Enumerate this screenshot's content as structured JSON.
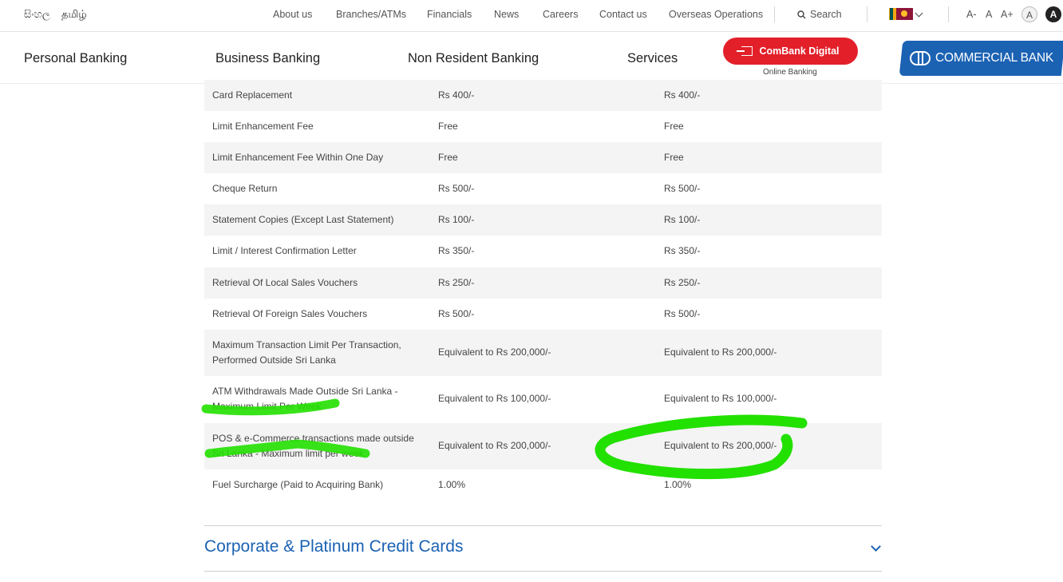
{
  "languages": {
    "sinhala": "සිංහල",
    "tamil": "தமிழ்"
  },
  "top_links": [
    "About us",
    "Branches/ATMs",
    "Financials",
    "News",
    "Careers",
    "Contact us",
    "Overseas Operations"
  ],
  "search": {
    "label": "Search",
    "icon": "search-icon"
  },
  "font_size_controls": [
    "A-",
    "A",
    "A+"
  ],
  "contrast_controls": {
    "light": "A",
    "dark": "A"
  },
  "main_nav": [
    "Personal Banking",
    "Business Banking",
    "Non Resident Banking",
    "Services"
  ],
  "combank_digital": {
    "label": "ComBank Digital",
    "sub": "Online Banking",
    "color": "#e3202a"
  },
  "logo": {
    "text": "COMMERCIAL BANK",
    "color": "#1b62b3"
  },
  "table_rows": [
    {
      "label": "Card Replacement",
      "col1": "Rs 400/-",
      "col2": "Rs 400/-"
    },
    {
      "label": "Limit Enhancement Fee",
      "col1": "Free",
      "col2": "Free"
    },
    {
      "label": "Limit Enhancement Fee Within One Day",
      "col1": "Free",
      "col2": "Free"
    },
    {
      "label": "Cheque Return",
      "col1": "Rs 500/-",
      "col2": "Rs 500/-"
    },
    {
      "label": "Statement Copies (Except Last Statement)",
      "col1": "Rs 100/-",
      "col2": "Rs 100/-"
    },
    {
      "label": "Limit / Interest Confirmation Letter",
      "col1": "Rs 350/-",
      "col2": "Rs 350/-"
    },
    {
      "label": "Retrieval Of Local Sales Vouchers",
      "col1": "Rs 250/-",
      "col2": "Rs 250/-"
    },
    {
      "label": "Retrieval Of Foreign Sales Vouchers",
      "col1": "Rs 500/-",
      "col2": "Rs 500/-"
    },
    {
      "label": "Maximum Transaction Limit Per Transaction, Performed Outside Sri Lanka",
      "col1": "Equivalent to Rs 200,000/-",
      "col2": "Equivalent to Rs 200,000/-"
    },
    {
      "label": "ATM Withdrawals Made Outside Sri Lanka - Maximum Limit Per Week",
      "col1": "Equivalent to Rs 100,000/-",
      "col2": "Equivalent to Rs 100,000/-"
    },
    {
      "label": "POS & e-Commerce transactions made outside Sri Lanka - Maximum limit per week",
      "col1": "Equivalent to Rs 200,000/-",
      "col2": "Equivalent to Rs 200,000/-"
    },
    {
      "label": "Fuel Surcharge (Paid to Acquiring Bank)",
      "col1": "1.00%",
      "col2": "1.00%"
    }
  ],
  "accordion": {
    "title": "Corporate & Platinum Credit Cards",
    "icon": "chevron-down-icon"
  },
  "annotation_color": "#22e000"
}
